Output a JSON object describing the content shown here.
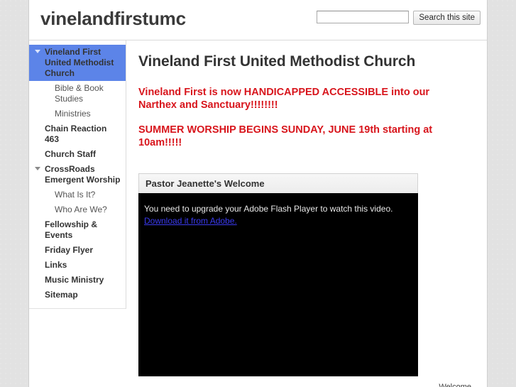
{
  "header": {
    "site_title": "vinelandfirstumc",
    "search": {
      "value": "",
      "placeholder": "",
      "button_label": "Search this site"
    }
  },
  "sidebar": {
    "items": [
      {
        "label": "Vineland First United Methodist Church",
        "level": 1,
        "selected": true,
        "toggle": "chevron-down-icon"
      },
      {
        "label": "Bible & Book Studies",
        "level": 2,
        "selected": false,
        "toggle": null
      },
      {
        "label": "Ministries",
        "level": 2,
        "selected": false,
        "toggle": null
      },
      {
        "label": "Chain Reaction 463",
        "level": 1,
        "selected": false,
        "toggle": null
      },
      {
        "label": "Church Staff",
        "level": 1,
        "selected": false,
        "toggle": null
      },
      {
        "label": "CrossRoads Emergent Worship",
        "level": 1,
        "selected": false,
        "toggle": "chevron-down-icon"
      },
      {
        "label": "What Is It?",
        "level": 2,
        "selected": false,
        "toggle": null
      },
      {
        "label": "Who Are We?",
        "level": 2,
        "selected": false,
        "toggle": null
      },
      {
        "label": "Fellowship & Events",
        "level": 1,
        "selected": false,
        "toggle": null
      },
      {
        "label": "Friday Flyer",
        "level": 1,
        "selected": false,
        "toggle": null
      },
      {
        "label": "Links",
        "level": 1,
        "selected": false,
        "toggle": null
      },
      {
        "label": "Music Ministry",
        "level": 1,
        "selected": false,
        "toggle": null
      },
      {
        "label": "Sitemap",
        "level": 1,
        "selected": false,
        "toggle": null
      }
    ]
  },
  "main": {
    "page_title": "Vineland First United Methodist Church",
    "announcements": [
      "Vineland First is now HANDICAPPED ACCESSIBLE into our Narthex and Sanctuary!!!!!!!!",
      "SUMMER WORSHIP BEGINS SUNDAY, JUNE 19th starting at 10am!!!!!"
    ],
    "video_module": {
      "title": "Pastor Jeanette's Welcome",
      "flash_message": "You need to upgrade your Adobe Flash Player to watch this video.",
      "flash_link_label": "Download it from Adobe."
    },
    "footer_note": "Welcome"
  },
  "colors": {
    "selection_blue": "#5c84e8",
    "announcement_red": "#d8151c",
    "link_blue": "#3a3aee",
    "page_background": "#e2e2e2"
  }
}
